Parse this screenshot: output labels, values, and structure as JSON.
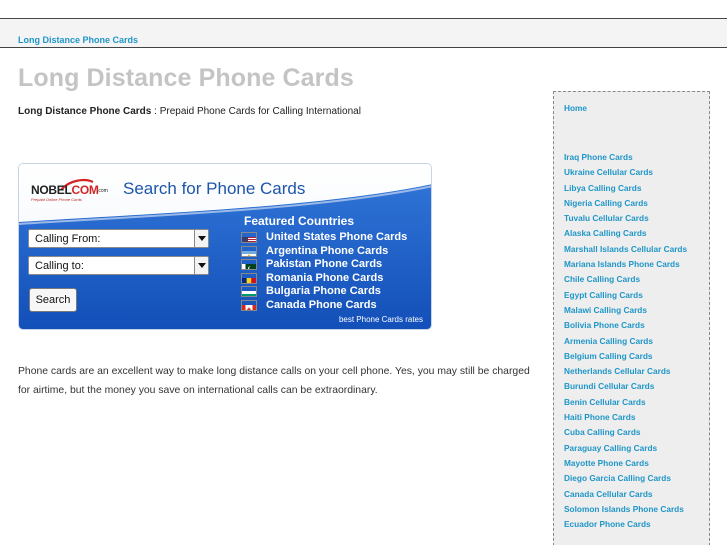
{
  "breadcrumb": "Long Distance Phone Cards",
  "page_title": "Long Distance Phone Cards",
  "tagline": {
    "bold": "Long Distance Phone Cards",
    "rest": " : Prepaid Phone Cards for Calling International"
  },
  "widget": {
    "logo": {
      "brand_prefix": "NOBEL",
      "brand_suffix": "COM",
      "dotcom": ".com",
      "sub": "Prepaid Online Phone Cards"
    },
    "title": "Search for Phone Cards",
    "featured_heading": "Featured Countries",
    "calling_from": "Calling From:",
    "calling_to": "Calling to:",
    "search_label": "Search",
    "countries": [
      {
        "name": "United States Phone Cards",
        "flag": "us-flag-icon"
      },
      {
        "name": "Argentina Phone Cards",
        "flag": "argentina-flag-icon"
      },
      {
        "name": "Pakistan Phone Cards",
        "flag": "pakistan-flag-icon"
      },
      {
        "name": "Romania Phone Cards",
        "flag": "romania-flag-icon"
      },
      {
        "name": "Bulgaria Phone Cards",
        "flag": "bulgaria-flag-icon"
      },
      {
        "name": "Canada Phone Cards",
        "flag": "canada-flag-icon"
      }
    ],
    "rates_text": "best Phone Cards rates",
    "colors": {
      "blue": "#1d5fc4",
      "title": "#1d56a8"
    }
  },
  "body_text": "Phone cards are an excellent way to make long distance calls on your cell phone. Yes, you may still be charged for airtime, but the money you save on international calls can be extraordinary.",
  "sidebar": {
    "home": "Home",
    "links": [
      "Iraq Phone Cards",
      "Ukraine Cellular Cards",
      "Libya Calling Cards",
      "Nigeria Calling Cards",
      "Tuvalu Cellular Cards",
      "Alaska Calling Cards",
      "Marshall Islands Cellular Cards",
      "Mariana Islands Phone Cards",
      "Chile Calling Cards",
      "Egypt Calling Cards",
      "Malawi Calling Cards",
      "Bolivia Phone Cards",
      "Armenia Calling Cards",
      "Belgium Calling Cards",
      "Netherlands Cellular Cards",
      "Burundi Cellular Cards",
      "Benin Cellular Cards",
      "Haiti Phone Cards",
      "Cuba Calling Cards",
      "Paraguay Calling Cards",
      "Mayotte Phone Cards",
      "Diego Garcia Calling Cards",
      "Canada Cellular Cards",
      "Solomon Islands Phone Cards",
      "Ecuador Phone Cards"
    ]
  },
  "link_color": "#1f96c8"
}
